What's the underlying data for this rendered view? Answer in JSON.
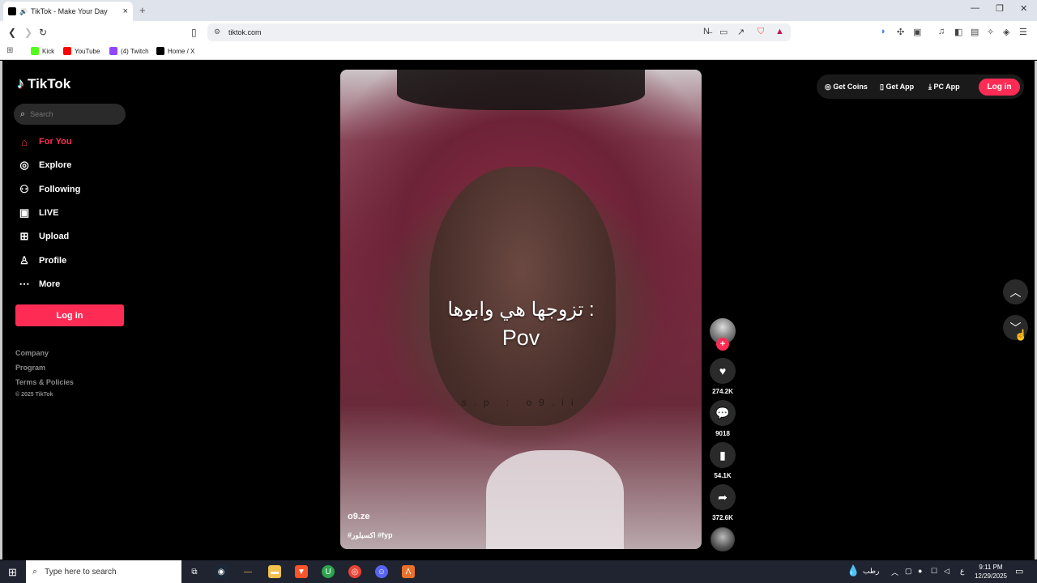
{
  "browser": {
    "tab_title": "TikTok - Make Your Day",
    "tab_close": "×",
    "new_tab": "+",
    "url": "tiktok.com",
    "window_controls": [
      "—",
      "❐",
      "✕"
    ]
  },
  "bookmarks": [
    {
      "label": "Kick",
      "color": "#53fc18"
    },
    {
      "label": "YouTube",
      "color": "#ff0000"
    },
    {
      "label": "(4) Twitch",
      "color": "#9146ff"
    },
    {
      "label": "Home / X",
      "color": "#000000"
    }
  ],
  "sidebar": {
    "brand": "TikTok",
    "search_placeholder": "Search",
    "items": [
      {
        "label": "For You",
        "icon": "home-icon",
        "active": true
      },
      {
        "label": "Explore",
        "icon": "compass-icon"
      },
      {
        "label": "Following",
        "icon": "following-icon"
      },
      {
        "label": "LIVE",
        "icon": "live-icon"
      },
      {
        "label": "Upload",
        "icon": "upload-icon"
      },
      {
        "label": "Profile",
        "icon": "profile-icon"
      },
      {
        "label": "More",
        "icon": "more-icon"
      }
    ],
    "login_label": "Log in",
    "footer": [
      "Company",
      "Program",
      "Terms & Policies"
    ],
    "copyright": "© 2025 TikTok"
  },
  "video": {
    "caption_line1": "تزوجها هي وابوها :",
    "caption_line2": "Pov",
    "watermark": "s.p : o9.ii",
    "author": "o9.ze",
    "tags": "#اكسبلور #fyp"
  },
  "actions": {
    "likes": "274.2K",
    "comments": "9018",
    "saves": "54.1K",
    "shares": "372.6K"
  },
  "topbar": {
    "get_coins": "Get Coins",
    "get_app": "Get App",
    "pc_app": "PC App",
    "login": "Log in"
  },
  "taskbar": {
    "search_placeholder": "Type here to search",
    "weather": "رطب",
    "time": "9:11 PM",
    "date": "12/29/2025"
  },
  "colors": {
    "accent": "#fe2c55",
    "background": "#000000"
  }
}
